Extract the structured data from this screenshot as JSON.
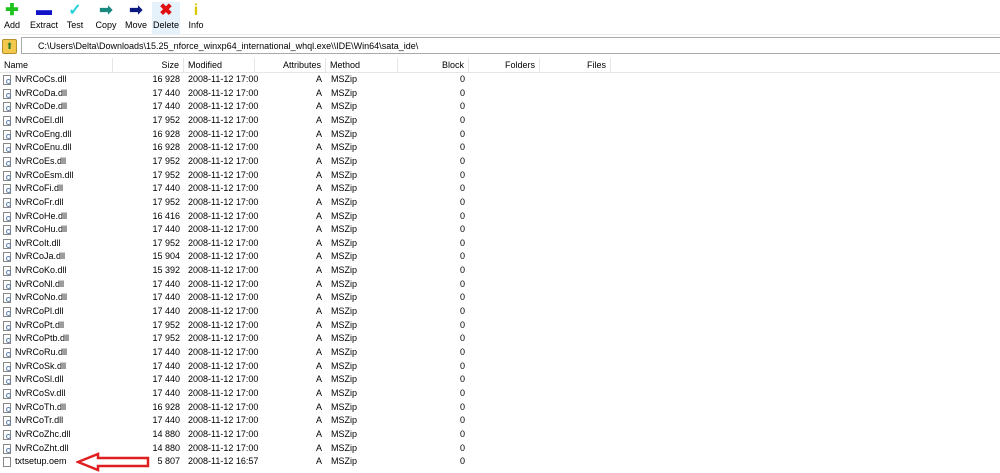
{
  "toolbar": {
    "buttons": [
      {
        "label": "Add",
        "icon": "plus-icon",
        "glyph": "✚",
        "color": "#1ec21e"
      },
      {
        "label": "Extract",
        "icon": "minus-icon",
        "glyph": "▬",
        "color": "#1212c8"
      },
      {
        "label": "Test",
        "icon": "check-icon",
        "glyph": "✓",
        "color": "#2ad0d8"
      },
      {
        "label": "Copy",
        "icon": "copy-arrow-icon",
        "glyph": "➡",
        "color": "#1a8a80"
      },
      {
        "label": "Move",
        "icon": "move-arrow-icon",
        "glyph": "➡",
        "color": "#0a1a80"
      },
      {
        "label": "Delete",
        "icon": "delete-x-icon",
        "glyph": "✖",
        "color": "#e01010"
      },
      {
        "label": "Info",
        "icon": "info-icon",
        "glyph": "i",
        "color": "#d8c800"
      }
    ]
  },
  "path": "C:\\Users\\Delta\\Downloads\\15.25_nforce_winxp64_international_whql.exe\\\\IDE\\Win64\\sata_ide\\",
  "columns": {
    "name": "Name",
    "size": "Size",
    "modified": "Modified",
    "attributes": "Attributes",
    "method": "Method",
    "block": "Block",
    "folders": "Folders",
    "files": "Files"
  },
  "rows": [
    [
      "NvRCoCs.dll",
      "16 928",
      "2008-11-12 17:00",
      "A",
      "MSZip",
      "0"
    ],
    [
      "NvRCoDa.dll",
      "17 440",
      "2008-11-12 17:00",
      "A",
      "MSZip",
      "0"
    ],
    [
      "NvRCoDe.dll",
      "17 440",
      "2008-11-12 17:00",
      "A",
      "MSZip",
      "0"
    ],
    [
      "NvRCoEl.dll",
      "17 952",
      "2008-11-12 17:00",
      "A",
      "MSZip",
      "0"
    ],
    [
      "NvRCoEng.dll",
      "16 928",
      "2008-11-12 17:00",
      "A",
      "MSZip",
      "0"
    ],
    [
      "NvRCoEnu.dll",
      "16 928",
      "2008-11-12 17:00",
      "A",
      "MSZip",
      "0"
    ],
    [
      "NvRCoEs.dll",
      "17 952",
      "2008-11-12 17:00",
      "A",
      "MSZip",
      "0"
    ],
    [
      "NvRCoEsm.dll",
      "17 952",
      "2008-11-12 17:00",
      "A",
      "MSZip",
      "0"
    ],
    [
      "NvRCoFi.dll",
      "17 440",
      "2008-11-12 17:00",
      "A",
      "MSZip",
      "0"
    ],
    [
      "NvRCoFr.dll",
      "17 952",
      "2008-11-12 17:00",
      "A",
      "MSZip",
      "0"
    ],
    [
      "NvRCoHe.dll",
      "16 416",
      "2008-11-12 17:00",
      "A",
      "MSZip",
      "0"
    ],
    [
      "NvRCoHu.dll",
      "17 440",
      "2008-11-12 17:00",
      "A",
      "MSZip",
      "0"
    ],
    [
      "NvRCoIt.dll",
      "17 952",
      "2008-11-12 17:00",
      "A",
      "MSZip",
      "0"
    ],
    [
      "NvRCoJa.dll",
      "15 904",
      "2008-11-12 17:00",
      "A",
      "MSZip",
      "0"
    ],
    [
      "NvRCoKo.dll",
      "15 392",
      "2008-11-12 17:00",
      "A",
      "MSZip",
      "0"
    ],
    [
      "NvRCoNl.dll",
      "17 440",
      "2008-11-12 17:00",
      "A",
      "MSZip",
      "0"
    ],
    [
      "NvRCoNo.dll",
      "17 440",
      "2008-11-12 17:00",
      "A",
      "MSZip",
      "0"
    ],
    [
      "NvRCoPl.dll",
      "17 440",
      "2008-11-12 17:00",
      "A",
      "MSZip",
      "0"
    ],
    [
      "NvRCoPt.dll",
      "17 952",
      "2008-11-12 17:00",
      "A",
      "MSZip",
      "0"
    ],
    [
      "NvRCoPtb.dll",
      "17 952",
      "2008-11-12 17:00",
      "A",
      "MSZip",
      "0"
    ],
    [
      "NvRCoRu.dll",
      "17 440",
      "2008-11-12 17:00",
      "A",
      "MSZip",
      "0"
    ],
    [
      "NvRCoSk.dll",
      "17 440",
      "2008-11-12 17:00",
      "A",
      "MSZip",
      "0"
    ],
    [
      "NvRCoSl.dll",
      "17 440",
      "2008-11-12 17:00",
      "A",
      "MSZip",
      "0"
    ],
    [
      "NvRCoSv.dll",
      "17 440",
      "2008-11-12 17:00",
      "A",
      "MSZip",
      "0"
    ],
    [
      "NvRCoTh.dll",
      "16 928",
      "2008-11-12 17:00",
      "A",
      "MSZip",
      "0"
    ],
    [
      "NvRCoTr.dll",
      "17 440",
      "2008-11-12 17:00",
      "A",
      "MSZip",
      "0"
    ],
    [
      "NvRCoZhc.dll",
      "14 880",
      "2008-11-12 17:00",
      "A",
      "MSZip",
      "0"
    ],
    [
      "NvRCoZht.dll",
      "14 880",
      "2008-11-12 17:00",
      "A",
      "MSZip",
      "0"
    ],
    [
      "txtsetup.oem",
      "5 807",
      "2008-11-12 16:57",
      "A",
      "MSZip",
      "0"
    ]
  ],
  "annotation": {
    "arrow_color": "#e02020"
  }
}
